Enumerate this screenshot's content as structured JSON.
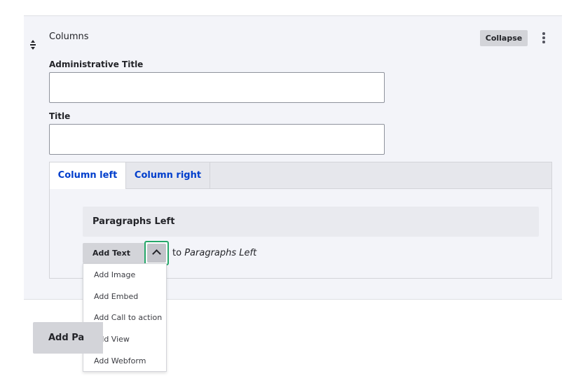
{
  "paragraph": {
    "title": "Columns",
    "collapse_label": "Collapse",
    "fields": {
      "admin_title": {
        "label": "Administrative Title",
        "value": ""
      },
      "title": {
        "label": "Title",
        "value": ""
      }
    },
    "tabs": [
      {
        "label": "Column left",
        "active": true
      },
      {
        "label": "Column right",
        "active": false
      }
    ],
    "paragraphs_left": {
      "title": "Paragraphs Left",
      "add_button_label": "Add Text",
      "to_prefix": "to",
      "to_target": "Paragraphs Left",
      "dropdown_items": [
        "Add Image",
        "Add Embed",
        "Add Call to action",
        "Add View",
        "Add Webform"
      ]
    }
  },
  "footer": {
    "add_paragraph_label": "Add Pa"
  },
  "icons": {
    "drag": "drag-handle-icon",
    "more": "kebab-menu-icon",
    "toggle": "chevron-up-icon"
  },
  "colors": {
    "tab_link": "#003ecc",
    "focus_ring": "#26a769",
    "panel_bg": "#f3f4f9"
  }
}
